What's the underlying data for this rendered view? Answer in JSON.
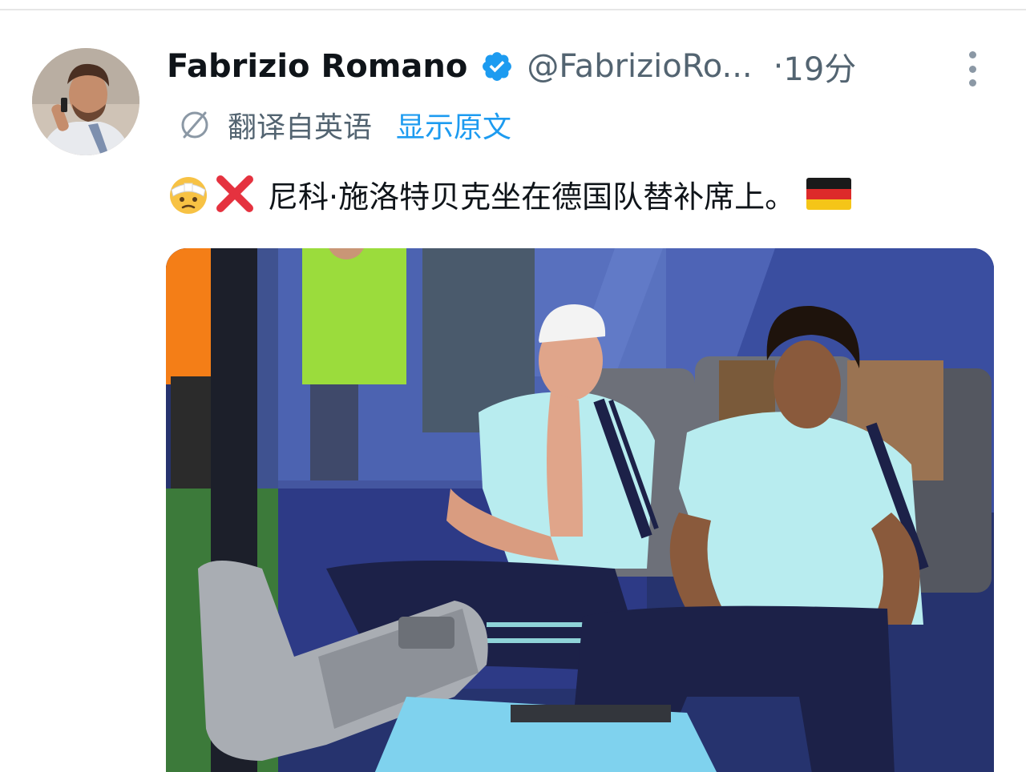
{
  "tweet": {
    "author": {
      "name": "Fabrizio Romano",
      "handle": "@FabrizioRo...",
      "verified": true
    },
    "time_separator": "·",
    "time": "19分",
    "translation": {
      "label": "翻译自英语",
      "show_original_label": "显示原文"
    },
    "text": "尼科·施洛特贝克坐在德国队替补席上。",
    "emojis": [
      "face-with-head-bandage-emoji",
      "cross-mark-emoji",
      "germany-flag-emoji"
    ],
    "colors": {
      "verified_blue": "#1d9bf0",
      "link_blue": "#1d9bf0",
      "secondary_text": "#536471",
      "primary_text": "#0f1419"
    }
  }
}
